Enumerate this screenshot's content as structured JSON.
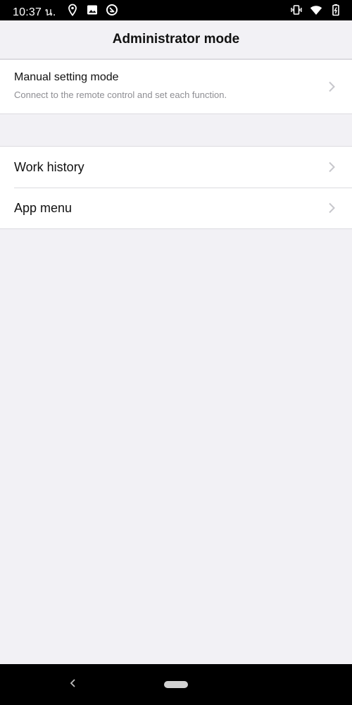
{
  "status_bar": {
    "time": "10:37 น.",
    "icons": [
      "location-icon",
      "image-icon",
      "data-saver-icon",
      "vibrate-icon",
      "wifi-icon",
      "battery-icon"
    ]
  },
  "header": {
    "title": "Administrator mode"
  },
  "menu": {
    "manual": {
      "title": "Manual setting mode",
      "subtitle": "Connect to the remote control and set each function."
    },
    "items": [
      {
        "label": "Work history"
      },
      {
        "label": "App menu"
      }
    ]
  },
  "colors": {
    "background": "#f2f1f5",
    "row_background": "#ffffff",
    "separator": "#dcdbe0",
    "chevron": "#c7c7cc",
    "subtitle": "#8e8e93"
  }
}
